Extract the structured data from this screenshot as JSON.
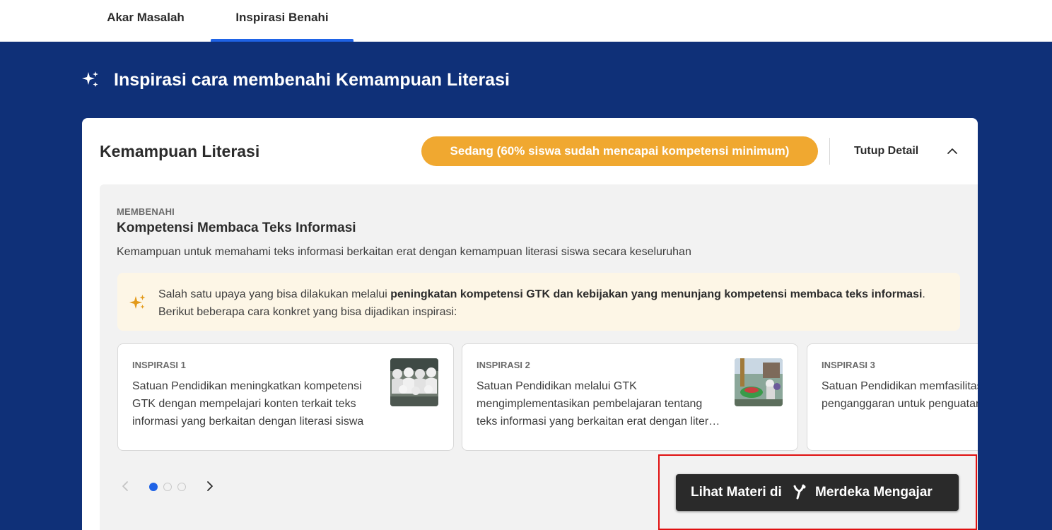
{
  "tabs": [
    {
      "label": "Akar Masalah",
      "active": false
    },
    {
      "label": "Inspirasi Benahi",
      "active": true
    }
  ],
  "section": {
    "icon": "sparkle-icon",
    "title": "Inspirasi cara membenahi Kemampuan Literasi"
  },
  "card": {
    "title": "Kemampuan Literasi",
    "level_badge": "Sedang (60% siswa sudah mencapai kompetensi minimum)",
    "level_color": "#f0a830",
    "close_label": "Tutup Detail",
    "close_icon": "chevron-up-icon"
  },
  "fix": {
    "eyebrow": "MEMBENAHI",
    "title": "Kompetensi Membaca Teks Informasi",
    "description": "Kemampuan untuk memahami teks informasi berkaitan erat dengan kemampuan literasi siswa secara keseluruhan"
  },
  "tip": {
    "icon": "sparkle-icon",
    "prefix": "Salah satu upaya yang bisa dilakukan melalui ",
    "bold": "peningkatan kompetensi GTK dan kebijakan yang menunjang kompetensi membaca teks informasi",
    "suffix": ". Berikut beberapa cara konkret yang bisa dijadikan inspirasi:"
  },
  "inspirations": [
    {
      "label": "INSPIRASI 1",
      "text": "Satuan Pendidikan meningkatkan kompetensi GTK dengan mempelajari konten terkait teks informasi yang berkaitan dengan literasi siswa"
    },
    {
      "label": "INSPIRASI 2",
      "text": "Satuan Pendidikan melalui GTK mengimplementasikan pembelajaran tentang teks informasi yang berkaitan erat dengan literasi siswa"
    },
    {
      "label": "INSPIRASI 3",
      "text": "Satuan Pendidikan memfasilitasi kebijakan dan penganggaran untuk penguatan literasi"
    }
  ],
  "pager": {
    "pages": 3,
    "current": 1
  },
  "cta": {
    "label_prefix": "Lihat Materi di",
    "logo": "merdeka-mengajar-logo",
    "label_suffix": "Merdeka Mengajar"
  },
  "colors": {
    "navy_background": "#0f3078",
    "accent_blue": "#1f63e6",
    "badge_amber": "#f0a830",
    "tip_background": "#fdf6e6",
    "highlight_red": "#e01010"
  }
}
